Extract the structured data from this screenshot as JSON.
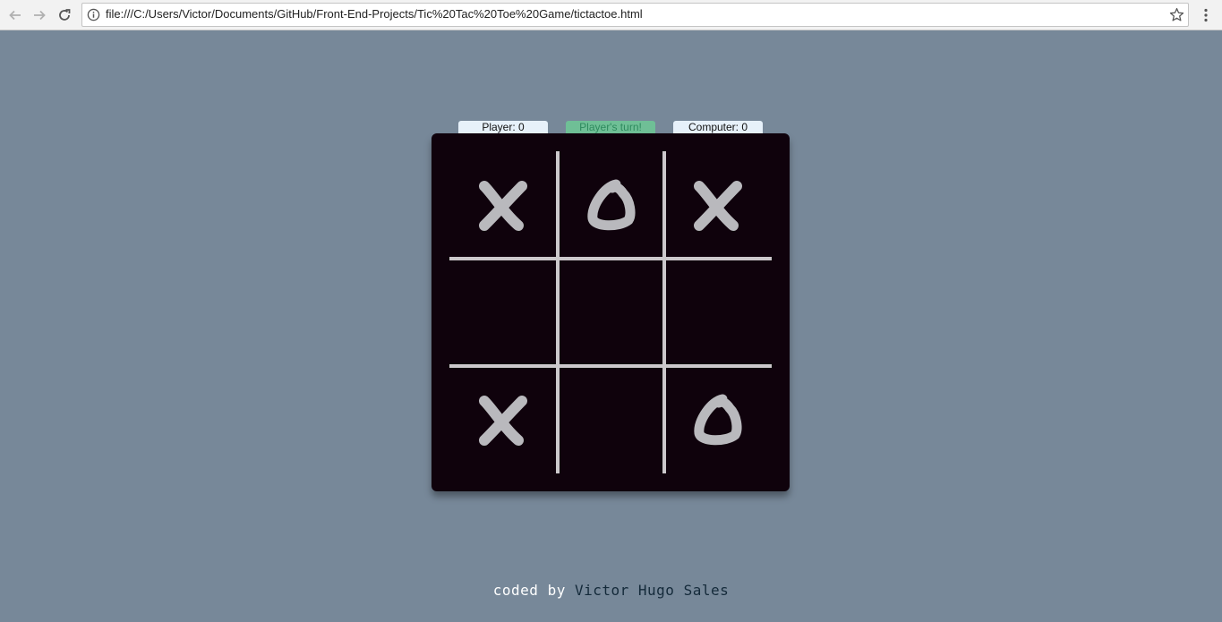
{
  "browser": {
    "url": "file:///C:/Users/Victor/Documents/GitHub/Front-End-Projects/Tic%20Tac%20Toe%20Game/tictactoe.html"
  },
  "scoreboard": {
    "player": "Player: 0",
    "turn": "Player's turn!",
    "computer": "Computer: 0"
  },
  "board": {
    "cells": [
      "X",
      "O",
      "X",
      "",
      "",
      "",
      "X",
      "",
      "O"
    ]
  },
  "footer": {
    "prefix": "coded by",
    "author": "Victor Hugo Sales"
  },
  "colors": {
    "background": "#778899",
    "board": "#0f020c",
    "grid_lines": "#cbc8cb",
    "marks": "#b9b9bd",
    "turn_badge": "#6fbf96"
  }
}
